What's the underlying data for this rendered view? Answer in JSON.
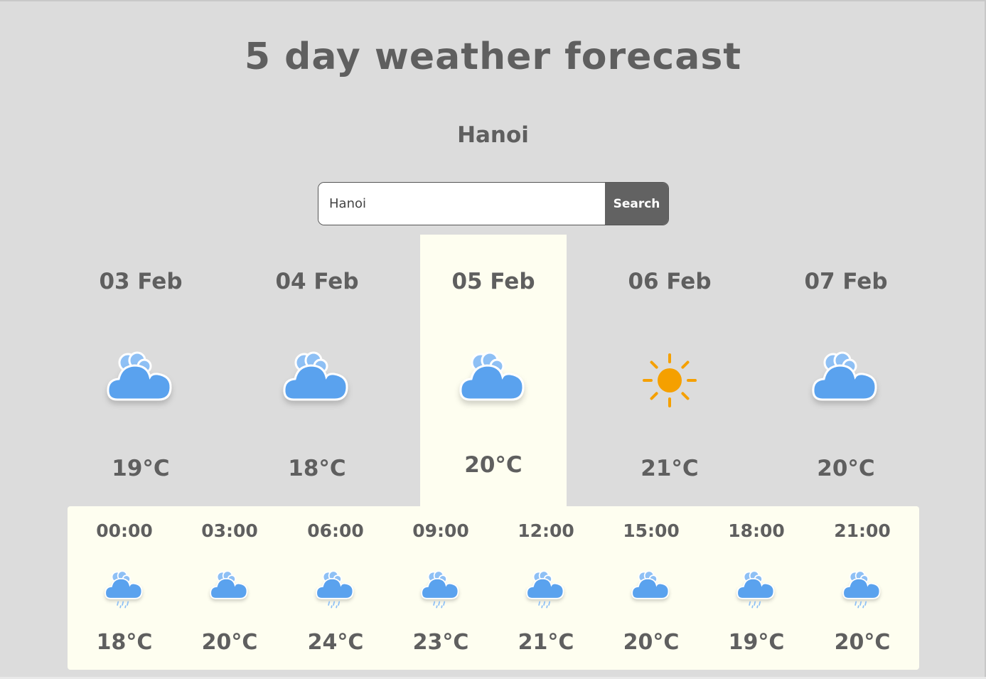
{
  "page": {
    "title": "5 day weather forecast",
    "city": "Hanoi"
  },
  "search": {
    "value": "Hanoi",
    "button_label": "Search"
  },
  "days": [
    {
      "date": "03 Feb",
      "icon": "cloud-icon",
      "temp": "19°C",
      "active": false
    },
    {
      "date": "04 Feb",
      "icon": "cloud-icon",
      "temp": "18°C",
      "active": false
    },
    {
      "date": "05 Feb",
      "icon": "cloud-icon",
      "temp": "20°C",
      "active": true
    },
    {
      "date": "06 Feb",
      "icon": "sun-icon",
      "temp": "21°C",
      "active": false
    },
    {
      "date": "07 Feb",
      "icon": "cloud-icon",
      "temp": "20°C",
      "active": false
    }
  ],
  "hours": [
    {
      "time": "00:00",
      "icon": "rain-cloud-icon",
      "temp": "18°C"
    },
    {
      "time": "03:00",
      "icon": "cloud-icon",
      "temp": "20°C"
    },
    {
      "time": "06:00",
      "icon": "rain-cloud-icon",
      "temp": "24°C"
    },
    {
      "time": "09:00",
      "icon": "rain-cloud-icon",
      "temp": "23°C"
    },
    {
      "time": "12:00",
      "icon": "rain-cloud-icon",
      "temp": "21°C"
    },
    {
      "time": "15:00",
      "icon": "cloud-icon",
      "temp": "20°C"
    },
    {
      "time": "18:00",
      "icon": "rain-cloud-icon",
      "temp": "19°C"
    },
    {
      "time": "21:00",
      "icon": "rain-cloud-icon",
      "temp": "20°C"
    }
  ],
  "colors": {
    "background": "#dcdcdc",
    "active_panel": "#fefef0",
    "text": "#5f5f5f",
    "cloud_blue": "#5aa2ee",
    "cloud_light": "#8ec0f5",
    "sun_orange": "#f5a000",
    "button": "#626262"
  }
}
